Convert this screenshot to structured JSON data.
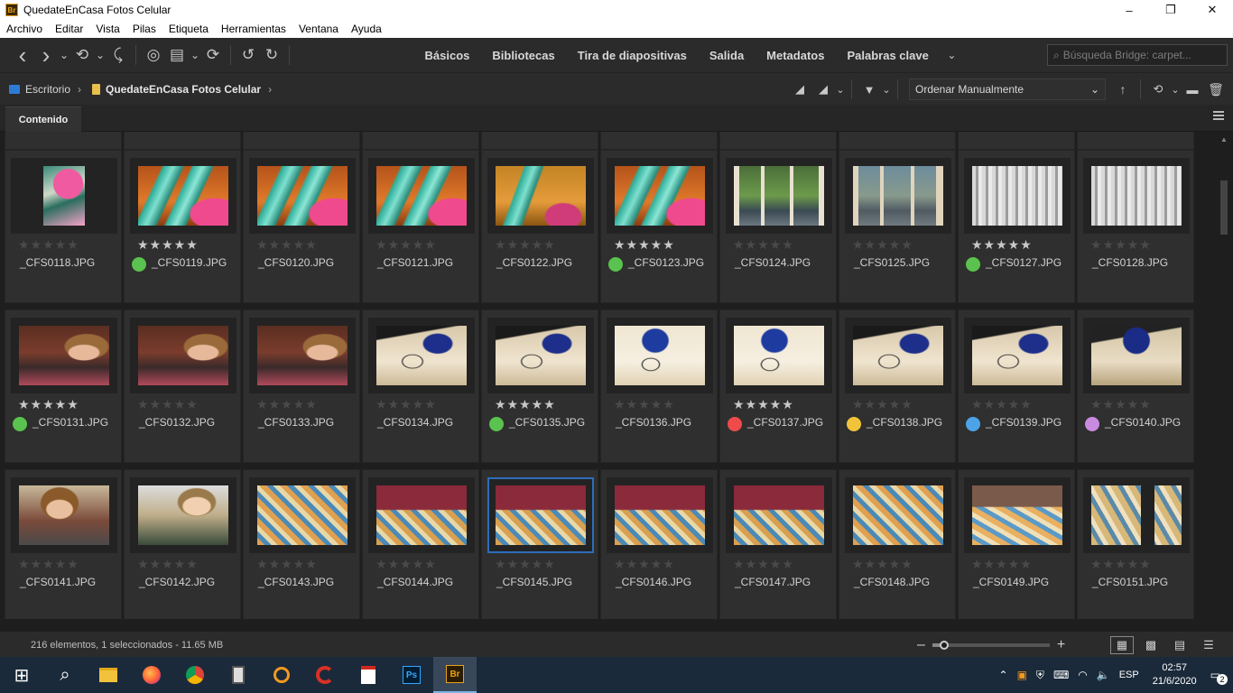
{
  "window": {
    "app_icon": "Br",
    "title": "QuedateEnCasa Fotos Celular",
    "minimize": "–",
    "maximize": "❐",
    "close": "✕"
  },
  "menu": [
    "Archivo",
    "Editar",
    "Vista",
    "Pilas",
    "Etiqueta",
    "Herramientas",
    "Ventana",
    "Ayuda"
  ],
  "toolbar": {
    "back_icon": "‹",
    "forward_icon": "›",
    "dropdown_icon": "⌄",
    "history_icon": "⟲",
    "boomerang_icon": "⤹",
    "camera_icon": "◎",
    "refine_icon": "▤",
    "sync_icon": "⟳",
    "rotate_left_icon": "↺",
    "rotate_right_icon": "↻"
  },
  "workspaces": [
    "Básicos",
    "Bibliotecas",
    "Tira de diapositivas",
    "Salida",
    "Metadatos",
    "Palabras clave"
  ],
  "workspace_more": "⌄",
  "search": {
    "placeholder": "Búsqueda Bridge: carpet..."
  },
  "breadcrumb": {
    "root": "Escritorio",
    "folder": "QuedateEnCasa Fotos Celular",
    "separator": "›"
  },
  "sort": {
    "quality_icon": "◢",
    "filter_icon": "▼",
    "value": "Ordenar Manualmente",
    "ascending_icon": "↑",
    "new_folder_icon": "▬",
    "delete_icon": "🗑"
  },
  "tab": {
    "label": "Contenido"
  },
  "colors": {
    "green": "#5ac24e",
    "red": "#ef4b4b",
    "yellow": "#f0c33a",
    "blue": "#4ea3e8",
    "purple": "#c88be0"
  },
  "rows": [
    [
      {
        "name": "_CFS0118.JPG",
        "rating": 0,
        "label": null,
        "thumb": "pink_narrow"
      },
      {
        "name": "_CFS0119.JPG",
        "rating": 5,
        "label": "green",
        "thumb": "sign"
      },
      {
        "name": "_CFS0120.JPG",
        "rating": 0,
        "label": null,
        "thumb": "sign"
      },
      {
        "name": "_CFS0121.JPG",
        "rating": 0,
        "label": null,
        "thumb": "sign"
      },
      {
        "name": "_CFS0122.JPG",
        "rating": 0,
        "label": null,
        "thumb": "sign2"
      },
      {
        "name": "_CFS0123.JPG",
        "rating": 5,
        "label": "green",
        "thumb": "sign"
      },
      {
        "name": "_CFS0124.JPG",
        "rating": 0,
        "label": null,
        "thumb": "window"
      },
      {
        "name": "_CFS0125.JPG",
        "rating": 0,
        "label": null,
        "thumb": "window2"
      },
      {
        "name": "_CFS0127.JPG",
        "rating": 5,
        "label": "green",
        "thumb": "curtain"
      },
      {
        "name": "_CFS0128.JPG",
        "rating": 0,
        "label": null,
        "thumb": "curtain"
      }
    ],
    [
      {
        "name": "_CFS0131.JPG",
        "rating": 5,
        "label": "green",
        "thumb": "girl"
      },
      {
        "name": "_CFS0132.JPG",
        "rating": 0,
        "label": null,
        "thumb": "girl"
      },
      {
        "name": "_CFS0133.JPG",
        "rating": 0,
        "label": null,
        "thumb": "girl"
      },
      {
        "name": "_CFS0134.JPG",
        "rating": 0,
        "label": null,
        "thumb": "desk"
      },
      {
        "name": "_CFS0135.JPG",
        "rating": 5,
        "label": "green",
        "thumb": "desk"
      },
      {
        "name": "_CFS0136.JPG",
        "rating": 0,
        "label": null,
        "thumb": "desk2"
      },
      {
        "name": "_CFS0137.JPG",
        "rating": 5,
        "label": "red",
        "thumb": "desk2"
      },
      {
        "name": "_CFS0138.JPG",
        "rating": 0,
        "label": "yellow",
        "thumb": "desk"
      },
      {
        "name": "_CFS0139.JPG",
        "rating": 0,
        "label": "blue",
        "thumb": "desk"
      },
      {
        "name": "_CFS0140.JPG",
        "rating": 0,
        "label": "purple",
        "thumb": "desk3"
      }
    ],
    [
      {
        "name": "_CFS0141.JPG",
        "rating": 0,
        "label": null,
        "thumb": "kid"
      },
      {
        "name": "_CFS0142.JPG",
        "rating": 0,
        "label": null,
        "thumb": "kid2"
      },
      {
        "name": "_CFS0143.JPG",
        "rating": 0,
        "label": null,
        "thumb": "game"
      },
      {
        "name": "_CFS0144.JPG",
        "rating": 0,
        "label": null,
        "thumb": "game2"
      },
      {
        "name": "_CFS0145.JPG",
        "rating": 0,
        "label": null,
        "thumb": "game2",
        "selected": true
      },
      {
        "name": "_CFS0146.JPG",
        "rating": 0,
        "label": null,
        "thumb": "game2"
      },
      {
        "name": "_CFS0147.JPG",
        "rating": 0,
        "label": null,
        "thumb": "game2"
      },
      {
        "name": "_CFS0148.JPG",
        "rating": 0,
        "label": null,
        "thumb": "game"
      },
      {
        "name": "_CFS0149.JPG",
        "rating": 0,
        "label": null,
        "thumb": "game3"
      },
      {
        "name": "_CFS0151.JPG",
        "rating": 0,
        "label": null,
        "thumb": "game4"
      }
    ]
  ],
  "status": {
    "text": "216 elementos, 1 seleccionados - 11.65 MB",
    "zoom_out": "–",
    "zoom_in": "+",
    "zoom_level": 0.1
  },
  "taskbar": {
    "start_icon": "⊞",
    "search_icon": "⌕",
    "apps": [
      "file-explorer",
      "firefox",
      "chrome",
      "calculator",
      "search-app",
      "ccleaner",
      "acrobat",
      "photoshop",
      "bridge"
    ],
    "ps_label": "Ps",
    "br_label": "Br",
    "language": "ESP",
    "time": "02:57",
    "date": "21/6/2020",
    "notifications": "2"
  }
}
